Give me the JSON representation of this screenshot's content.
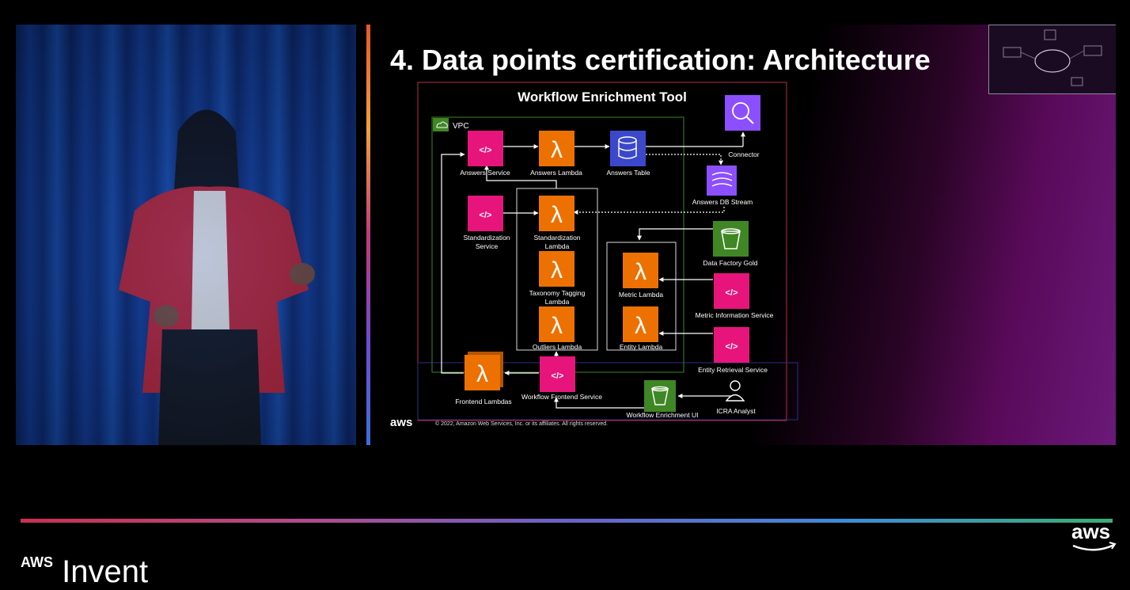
{
  "slide": {
    "title": "4. Data points certification: Architecture",
    "aws_logo": "aws",
    "copyright": "© 2022, Amazon Web Services, Inc. or its affiliates. All rights reserved."
  },
  "diagram": {
    "title": "Workflow Enrichment Tool",
    "vpc_label": "VPC",
    "nodes": {
      "answers_service": "Answers Service",
      "answers_lambda": "Answers Lambda",
      "answers_table": "Answers Table",
      "connector": "Connector",
      "answers_db_stream": "Answers DB Stream",
      "standardization_service_1": "Standardization",
      "standardization_service_2": "Service",
      "standardization_lambda_1": "Standardization",
      "standardization_lambda_2": "Lambda",
      "taxonomy_lambda_1": "Taxonomy Tagging",
      "taxonomy_lambda_2": "Lambda",
      "outliers_lambda": "Outliers Lambda",
      "data_factory_gold": "Data Factory Gold",
      "metric_lambda": "Metric Lambda",
      "metric_information_service": "Metric Information Service",
      "entity_lambda": "Entity Lambda",
      "entity_retrieval_service": "Entity Retrieval Service",
      "frontend_lambdas": "Frontend Lambdas",
      "workflow_frontend_service": "Workflow Frontend Service",
      "workflow_enrichment_ui": "Workflow Enrichment UI",
      "icra_analyst": "ICRA Analyst"
    },
    "icons": {
      "lambda_symbol": "λ",
      "api_symbol": "</>"
    },
    "colors": {
      "api_gateway": "#e7157b",
      "lambda": "#ed7100",
      "database": "#3b48cc",
      "storage": "#3f8624",
      "analytics": "#8c4fff",
      "vpc_border": "#3f8624",
      "outer_border": "#b3304a"
    }
  },
  "footer": {
    "brand_small": "AWS",
    "brand_large": "Invent",
    "aws_logo": "aws"
  }
}
